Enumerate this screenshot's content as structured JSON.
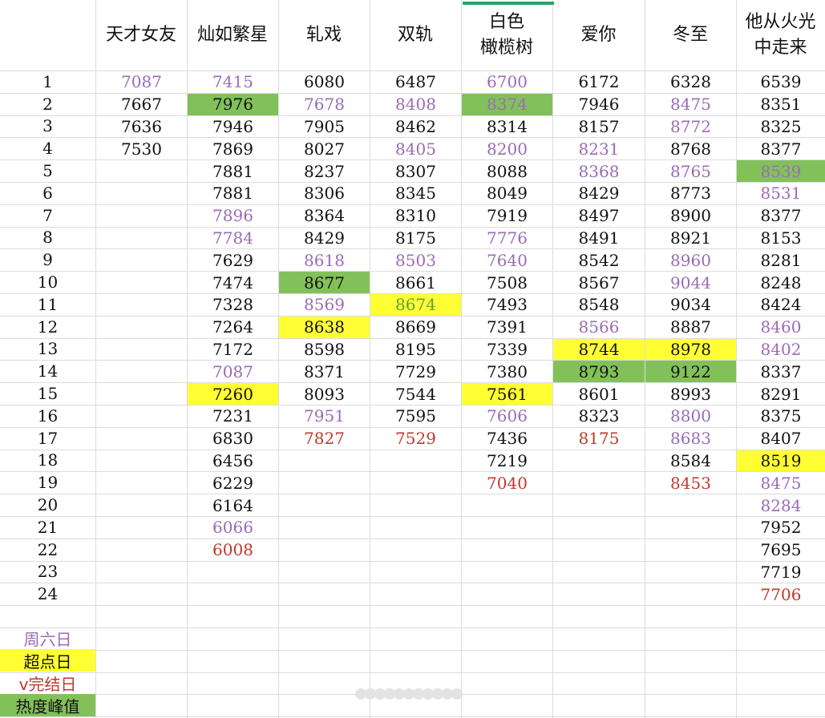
{
  "columns": [
    "天才女友",
    "灿如繁星",
    "轧戏",
    "双轨",
    "白色\n橄榄树",
    "爱你",
    "冬至",
    "他从火光\n中走来"
  ],
  "rows": [
    {
      "n": "1",
      "cells": [
        "7087",
        "7415",
        "6080",
        "6487",
        "6700",
        "6172",
        "6328",
        "6539"
      ]
    },
    {
      "n": "2",
      "cells": [
        "7667",
        "7976",
        "7678",
        "8408",
        "8374",
        "7946",
        "8475",
        "8351"
      ]
    },
    {
      "n": "3",
      "cells": [
        "7636",
        "7946",
        "7905",
        "8462",
        "8314",
        "8157",
        "8772",
        "8325"
      ]
    },
    {
      "n": "4",
      "cells": [
        "7530",
        "7869",
        "8027",
        "8405",
        "8200",
        "8231",
        "8768",
        "8377"
      ]
    },
    {
      "n": "5",
      "cells": [
        "",
        "7881",
        "8237",
        "8307",
        "8088",
        "8368",
        "8765",
        "8539"
      ]
    },
    {
      "n": "6",
      "cells": [
        "",
        "7881",
        "8306",
        "8345",
        "8049",
        "8429",
        "8773",
        "8531"
      ]
    },
    {
      "n": "7",
      "cells": [
        "",
        "7896",
        "8364",
        "8310",
        "7919",
        "8497",
        "8900",
        "8377"
      ]
    },
    {
      "n": "8",
      "cells": [
        "",
        "7784",
        "8429",
        "8175",
        "7776",
        "8491",
        "8921",
        "8153"
      ]
    },
    {
      "n": "9",
      "cells": [
        "",
        "7629",
        "8618",
        "8503",
        "7640",
        "8542",
        "8960",
        "8281"
      ]
    },
    {
      "n": "10",
      "cells": [
        "",
        "7474",
        "8677",
        "8661",
        "7508",
        "8567",
        "9044",
        "8248"
      ]
    },
    {
      "n": "11",
      "cells": [
        "",
        "7328",
        "8569",
        "8674",
        "7493",
        "8548",
        "9034",
        "8424"
      ]
    },
    {
      "n": "12",
      "cells": [
        "",
        "7264",
        "8638",
        "8669",
        "7391",
        "8566",
        "8887",
        "8460"
      ]
    },
    {
      "n": "13",
      "cells": [
        "",
        "7172",
        "8598",
        "8195",
        "7339",
        "8744",
        "8978",
        "8402"
      ]
    },
    {
      "n": "14",
      "cells": [
        "",
        "7087",
        "8371",
        "7729",
        "7380",
        "8793",
        "9122",
        "8337"
      ]
    },
    {
      "n": "15",
      "cells": [
        "",
        "7260",
        "8093",
        "7544",
        "7561",
        "8601",
        "8993",
        "8291"
      ]
    },
    {
      "n": "16",
      "cells": [
        "",
        "7231",
        "7951",
        "7595",
        "7606",
        "8323",
        "8800",
        "8375"
      ]
    },
    {
      "n": "17",
      "cells": [
        "",
        "6830",
        "7827",
        "7529",
        "7436",
        "8175",
        "8683",
        "8407"
      ]
    },
    {
      "n": "18",
      "cells": [
        "",
        "6456",
        "",
        "",
        "7219",
        "",
        "8584",
        "8519"
      ]
    },
    {
      "n": "19",
      "cells": [
        "",
        "6229",
        "",
        "",
        "7040",
        "",
        "8453",
        "8475"
      ]
    },
    {
      "n": "20",
      "cells": [
        "",
        "6164",
        "",
        "",
        "",
        "",
        "",
        "8284"
      ]
    },
    {
      "n": "21",
      "cells": [
        "",
        "6066",
        "",
        "",
        "",
        "",
        "",
        "7952"
      ]
    },
    {
      "n": "22",
      "cells": [
        "",
        "6008",
        "",
        "",
        "",
        "",
        "",
        "7695"
      ]
    },
    {
      "n": "23",
      "cells": [
        "",
        "",
        "",
        "",
        "",
        "",
        "",
        "7719"
      ]
    },
    {
      "n": "24",
      "cells": [
        "",
        "",
        "",
        "",
        "",
        "",
        "",
        "7706"
      ]
    }
  ],
  "styles": {
    "weekend": [
      [
        0,
        0
      ],
      [
        0,
        1
      ],
      [
        1,
        2
      ],
      [
        1,
        3
      ],
      [
        1,
        4
      ],
      [
        0,
        4
      ],
      [
        3,
        3
      ],
      [
        3,
        4
      ],
      [
        3,
        5
      ],
      [
        4,
        5
      ],
      [
        4,
        6
      ],
      [
        6,
        1
      ],
      [
        7,
        1
      ],
      [
        7,
        4
      ],
      [
        8,
        2
      ],
      [
        8,
        3
      ],
      [
        8,
        4
      ],
      [
        8,
        6
      ],
      [
        9,
        6
      ],
      [
        10,
        2
      ],
      [
        11,
        5
      ],
      [
        11,
        7
      ],
      [
        12,
        7
      ],
      [
        13,
        1
      ],
      [
        15,
        2
      ],
      [
        15,
        4
      ],
      [
        15,
        6
      ],
      [
        16,
        6
      ],
      [
        18,
        7
      ],
      [
        19,
        7
      ],
      [
        20,
        1
      ],
      [
        1,
        6
      ],
      [
        2,
        6
      ],
      [
        3,
        4
      ],
      [
        4,
        7
      ],
      [
        5,
        7
      ]
    ],
    "end": [
      [
        16,
        2
      ],
      [
        16,
        3
      ],
      [
        16,
        5
      ],
      [
        18,
        4
      ],
      [
        18,
        6
      ],
      [
        21,
        1
      ],
      [
        23,
        7
      ]
    ],
    "yellow": [
      [
        14,
        1
      ],
      [
        11,
        2
      ],
      [
        10,
        3
      ],
      [
        14,
        4
      ],
      [
        12,
        5
      ],
      [
        12,
        6
      ],
      [
        17,
        7
      ]
    ],
    "green": [
      [
        1,
        1
      ],
      [
        9,
        2
      ],
      [
        1,
        4
      ],
      [
        13,
        5
      ],
      [
        13,
        6
      ],
      [
        4,
        7
      ]
    ],
    "green_text": [
      [
        10,
        3
      ]
    ]
  },
  "legend": [
    {
      "label": "周六日",
      "style": "weekend"
    },
    {
      "label": "超点日",
      "style": "yellow"
    },
    {
      "label": "v完结日",
      "style": "end"
    },
    {
      "label": "热度峰值",
      "style": "green"
    }
  ],
  "colors": {
    "weekend": "#9b6bb6",
    "end": "#c0392b",
    "yellow": "#ffff33",
    "green": "#82c15a",
    "grid": "#dcdcdc",
    "selection": "#27a36d"
  }
}
